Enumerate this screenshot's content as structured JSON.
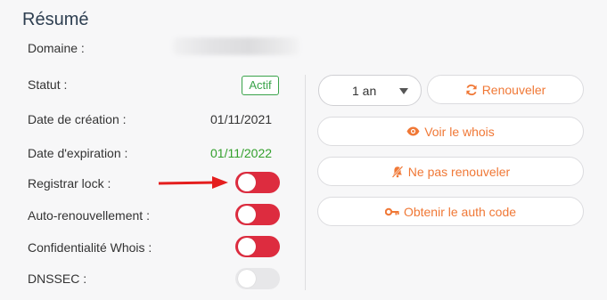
{
  "summary": {
    "title": "Résumé",
    "fields": {
      "domaine_label": "Domaine :",
      "statut_label": "Statut :",
      "statut_value": "Actif",
      "creation_label": "Date de création :",
      "creation_value": "01/11/2021",
      "expiration_label": "Date d'expiration :",
      "expiration_value": "01/11/2022",
      "registrar_lock_label": "Registrar lock :",
      "auto_renew_label": "Auto-renouvellement :",
      "whois_privacy_label": "Confidentialité Whois :",
      "dnssec_label": "DNSSEC :"
    },
    "toggles": {
      "registrar_lock": "off",
      "auto_renew": "off",
      "whois_privacy": "off",
      "dnssec": "disabled"
    }
  },
  "actions": {
    "duration_select": "1 an",
    "renew": "Renouveler",
    "whois": "Voir le whois",
    "no_renew": "Ne pas renouveler",
    "auth_code": "Obtenir le auth code"
  },
  "colors": {
    "accent": "#f07836",
    "toggle_red": "#dd2c3f",
    "status_green": "#3aa34a",
    "arrow": "#e41e1e"
  }
}
